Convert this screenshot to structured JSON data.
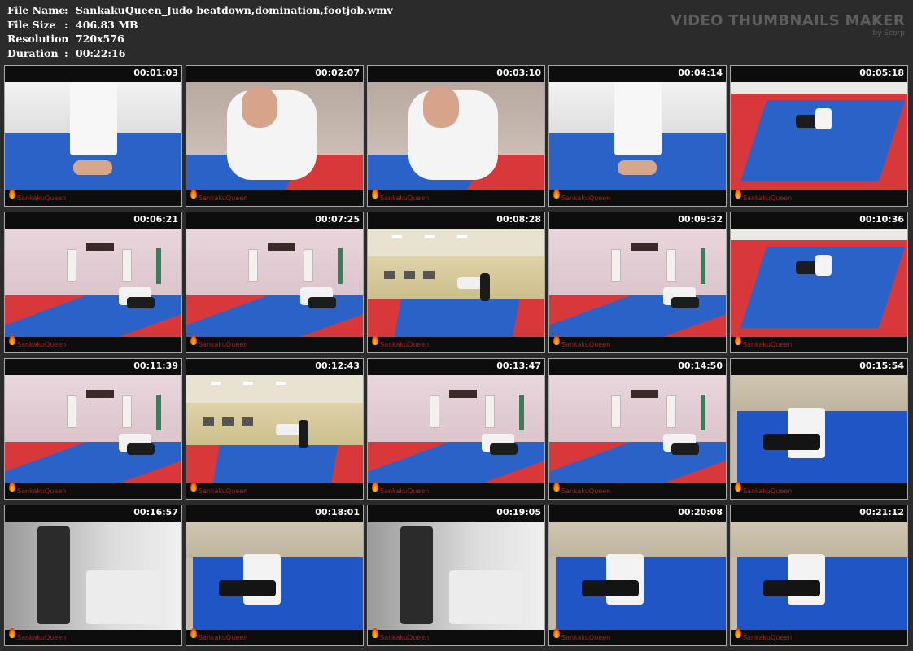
{
  "header": {
    "file_name_label": "File Name",
    "file_name": "SankakuQueen_Judo beatdown,domination,footjob.wmv",
    "file_size_label": "File Size",
    "file_size": "406.83 MB",
    "resolution_label": "Resolution",
    "resolution": "720x576",
    "duration_label": "Duration",
    "duration": "00:22:16",
    "separator": ":"
  },
  "brand": {
    "title": "VIDEO THUMBNAILS MAKER",
    "subtitle": "by Scorp"
  },
  "watermark": "SankakuQueen",
  "colors": {
    "background": "#2b2b2b",
    "mat_blue": "#2a62c8",
    "mat_red": "#d8383a",
    "watermark_red": "#b01e1e"
  },
  "thumbnails": [
    {
      "time": "00:01:03",
      "scene": "feet"
    },
    {
      "time": "00:02:07",
      "scene": "close"
    },
    {
      "time": "00:03:10",
      "scene": "close"
    },
    {
      "time": "00:04:14",
      "scene": "feet"
    },
    {
      "time": "00:05:18",
      "scene": "top"
    },
    {
      "time": "00:06:21",
      "scene": "dojo"
    },
    {
      "time": "00:07:25",
      "scene": "dojo"
    },
    {
      "time": "00:08:28",
      "scene": "hall"
    },
    {
      "time": "00:09:32",
      "scene": "dojo"
    },
    {
      "time": "00:10:36",
      "scene": "top"
    },
    {
      "time": "00:11:39",
      "scene": "dojo"
    },
    {
      "time": "00:12:43",
      "scene": "hall"
    },
    {
      "time": "00:13:47",
      "scene": "dojo"
    },
    {
      "time": "00:14:50",
      "scene": "dojo"
    },
    {
      "time": "00:15:54",
      "scene": "room"
    },
    {
      "time": "00:16:57",
      "scene": "gray"
    },
    {
      "time": "00:18:01",
      "scene": "room"
    },
    {
      "time": "00:19:05",
      "scene": "gray"
    },
    {
      "time": "00:20:08",
      "scene": "room"
    },
    {
      "time": "00:21:12",
      "scene": "room"
    }
  ]
}
